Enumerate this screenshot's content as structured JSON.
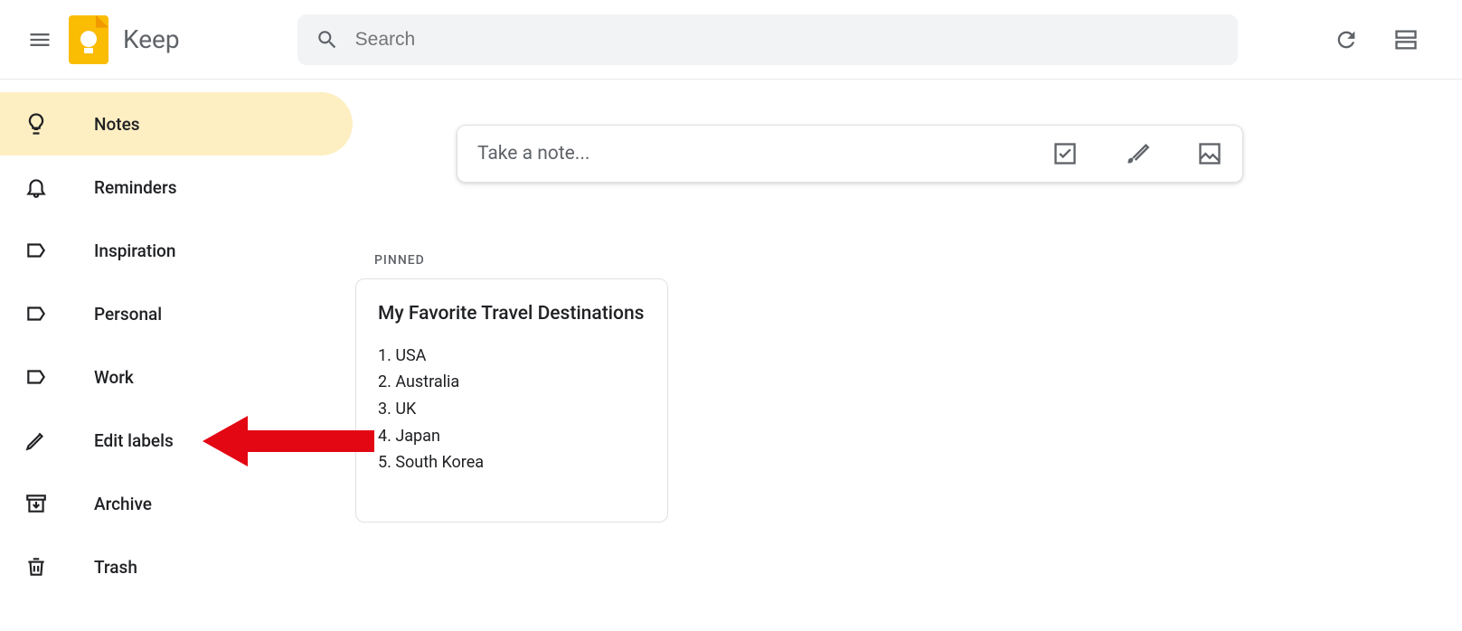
{
  "header": {
    "app_name": "Keep",
    "search_placeholder": "Search"
  },
  "sidebar": {
    "items": [
      {
        "label": "Notes",
        "icon": "lightbulb-icon",
        "active": true
      },
      {
        "label": "Reminders",
        "icon": "bell-icon",
        "active": false
      },
      {
        "label": "Inspiration",
        "icon": "label-icon",
        "active": false
      },
      {
        "label": "Personal",
        "icon": "label-icon",
        "active": false
      },
      {
        "label": "Work",
        "icon": "label-icon",
        "active": false
      },
      {
        "label": "Edit labels",
        "icon": "pencil-icon",
        "active": false
      },
      {
        "label": "Archive",
        "icon": "archive-icon",
        "active": false
      },
      {
        "label": "Trash",
        "icon": "trash-icon",
        "active": false
      }
    ]
  },
  "main": {
    "take_note_placeholder": "Take a note...",
    "section_label": "PINNED",
    "note": {
      "title": "My Favorite Travel Destinations",
      "items": [
        "1. USA",
        "2. Australia",
        "3. UK",
        "4. Japan",
        "5. South Korea"
      ]
    }
  },
  "annotation": {
    "points_to": "Edit labels",
    "color": "#e30613"
  }
}
